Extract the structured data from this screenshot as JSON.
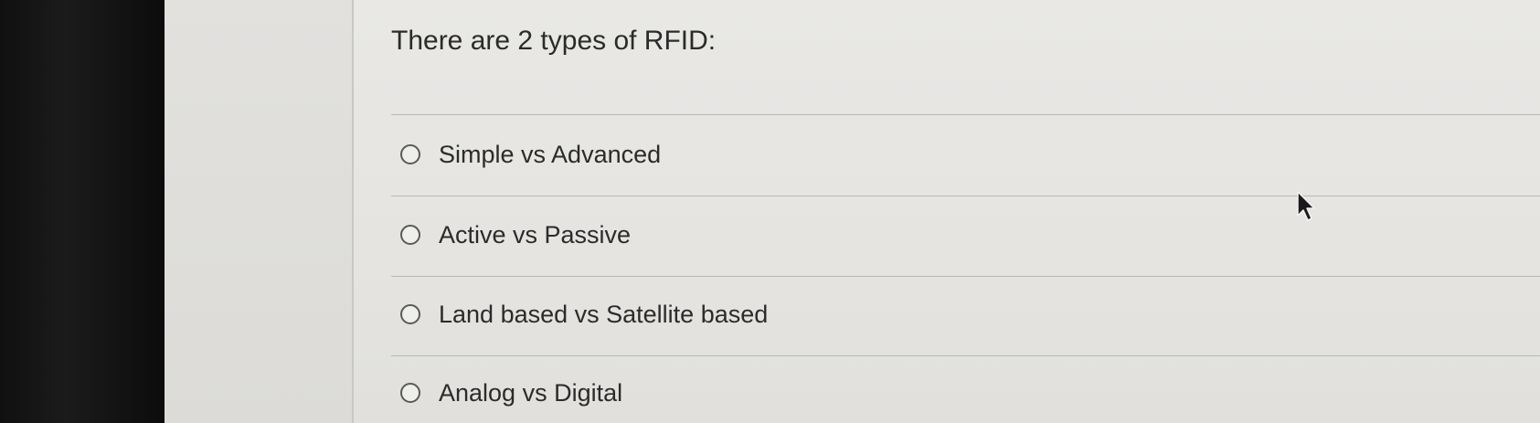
{
  "question": {
    "text": "There are 2 types of RFID:"
  },
  "options": [
    {
      "label": "Simple vs Advanced",
      "selected": false
    },
    {
      "label": "Active vs Passive",
      "selected": false
    },
    {
      "label": "Land based vs Satellite based",
      "selected": false
    },
    {
      "label": "Analog vs Digital",
      "selected": false
    }
  ],
  "icons": {
    "radio": "radio-circle-icon",
    "cursor": "mouse-pointer-icon"
  },
  "colors": {
    "background": "#e7e6e3",
    "text": "#2b2b2b",
    "rule": "#b9b8b5",
    "bezel": "#111111"
  }
}
